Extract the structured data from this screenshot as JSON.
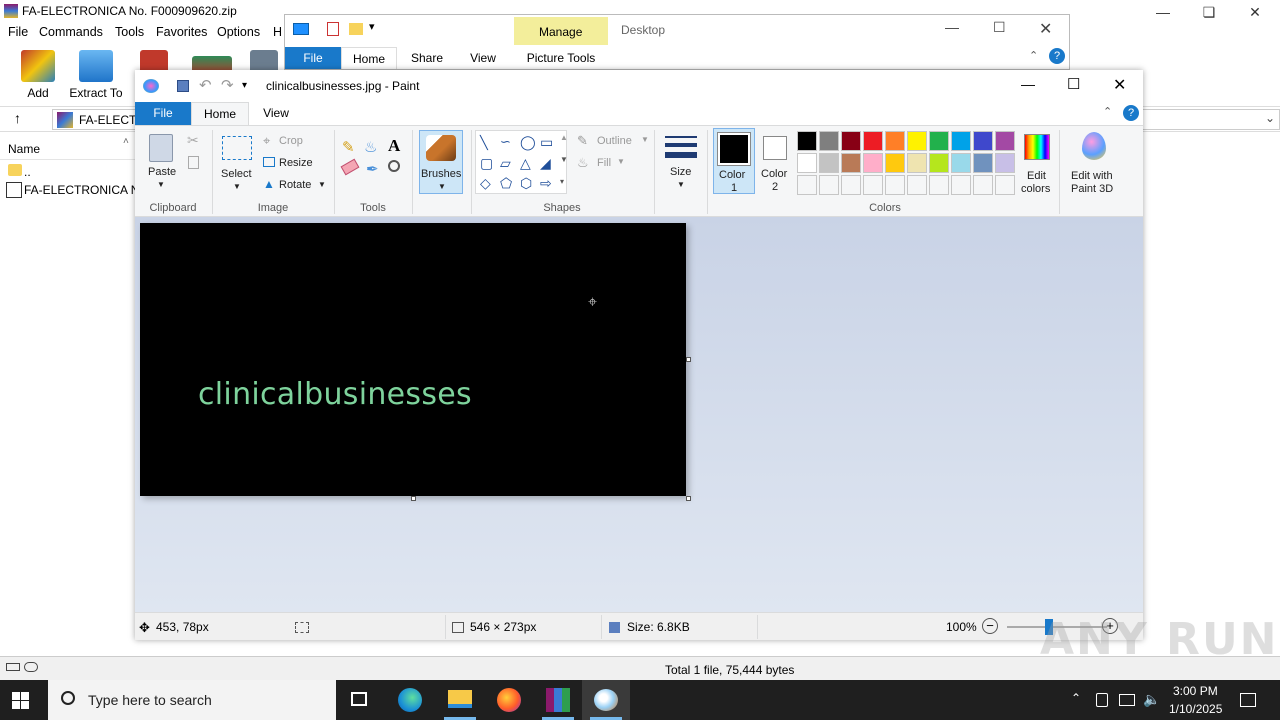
{
  "winrar": {
    "title": "FA-ELECTRONICA No. F000909620.zip",
    "menu": [
      "File",
      "Commands",
      "Tools",
      "Favorites",
      "Options",
      "H"
    ],
    "toolbar": {
      "add": "Add",
      "extract": "Extract To"
    },
    "address": "FA-ELECTR",
    "list_header": "Name",
    "list_items": [
      "..",
      "FA-ELECTRONICA No"
    ],
    "status": "Total 1 file, 75,444 bytes"
  },
  "explorer": {
    "tabs": {
      "file": "File",
      "home": "Home",
      "share": "Share",
      "view": "View",
      "manage": "Manage",
      "picture_tools": "Picture Tools",
      "desktop": "Desktop"
    }
  },
  "paint": {
    "title": "clinicalbusinesses.jpg - Paint",
    "tabs": {
      "file": "File",
      "home": "Home",
      "view": "View"
    },
    "clipboard": {
      "paste": "Paste",
      "group": "Clipboard"
    },
    "image": {
      "select": "Select",
      "crop": "Crop",
      "resize": "Resize",
      "rotate": "Rotate",
      "group": "Image"
    },
    "tools": {
      "group": "Tools"
    },
    "brushes": "Brushes",
    "shapes": {
      "outline": "Outline",
      "fill": "Fill",
      "group": "Shapes"
    },
    "size": "Size",
    "color1": {
      "label": "Color",
      "num": "1"
    },
    "color2": {
      "label": "Color",
      "num": "2"
    },
    "colors_group": "Colors",
    "edit_colors": {
      "line1": "Edit",
      "line2": "colors"
    },
    "edit3d": {
      "line1": "Edit with",
      "line2": "Paint 3D"
    },
    "canvas_text": "clinicalbusinesses",
    "status": {
      "position": "453, 78px",
      "size": "546 × 273px",
      "file_size": "Size: 6.8KB",
      "zoom": "100%"
    },
    "palette_row1": [
      "#000000",
      "#7f7f7f",
      "#880015",
      "#ed1c24",
      "#ff7f27",
      "#fff200",
      "#22b14c",
      "#00a2e8",
      "#3f48cc",
      "#a349a4"
    ],
    "palette_row2": [
      "#ffffff",
      "#c3c3c3",
      "#b97a57",
      "#ffaec9",
      "#ffc90e",
      "#efe4b0",
      "#b5e61d",
      "#99d9ea",
      "#7092be",
      "#c8bfe7"
    ]
  },
  "taskbar": {
    "search_placeholder": "Type here to search",
    "time": "3:00 PM",
    "date": "1/10/2025"
  },
  "watermark": "ANY RUN"
}
